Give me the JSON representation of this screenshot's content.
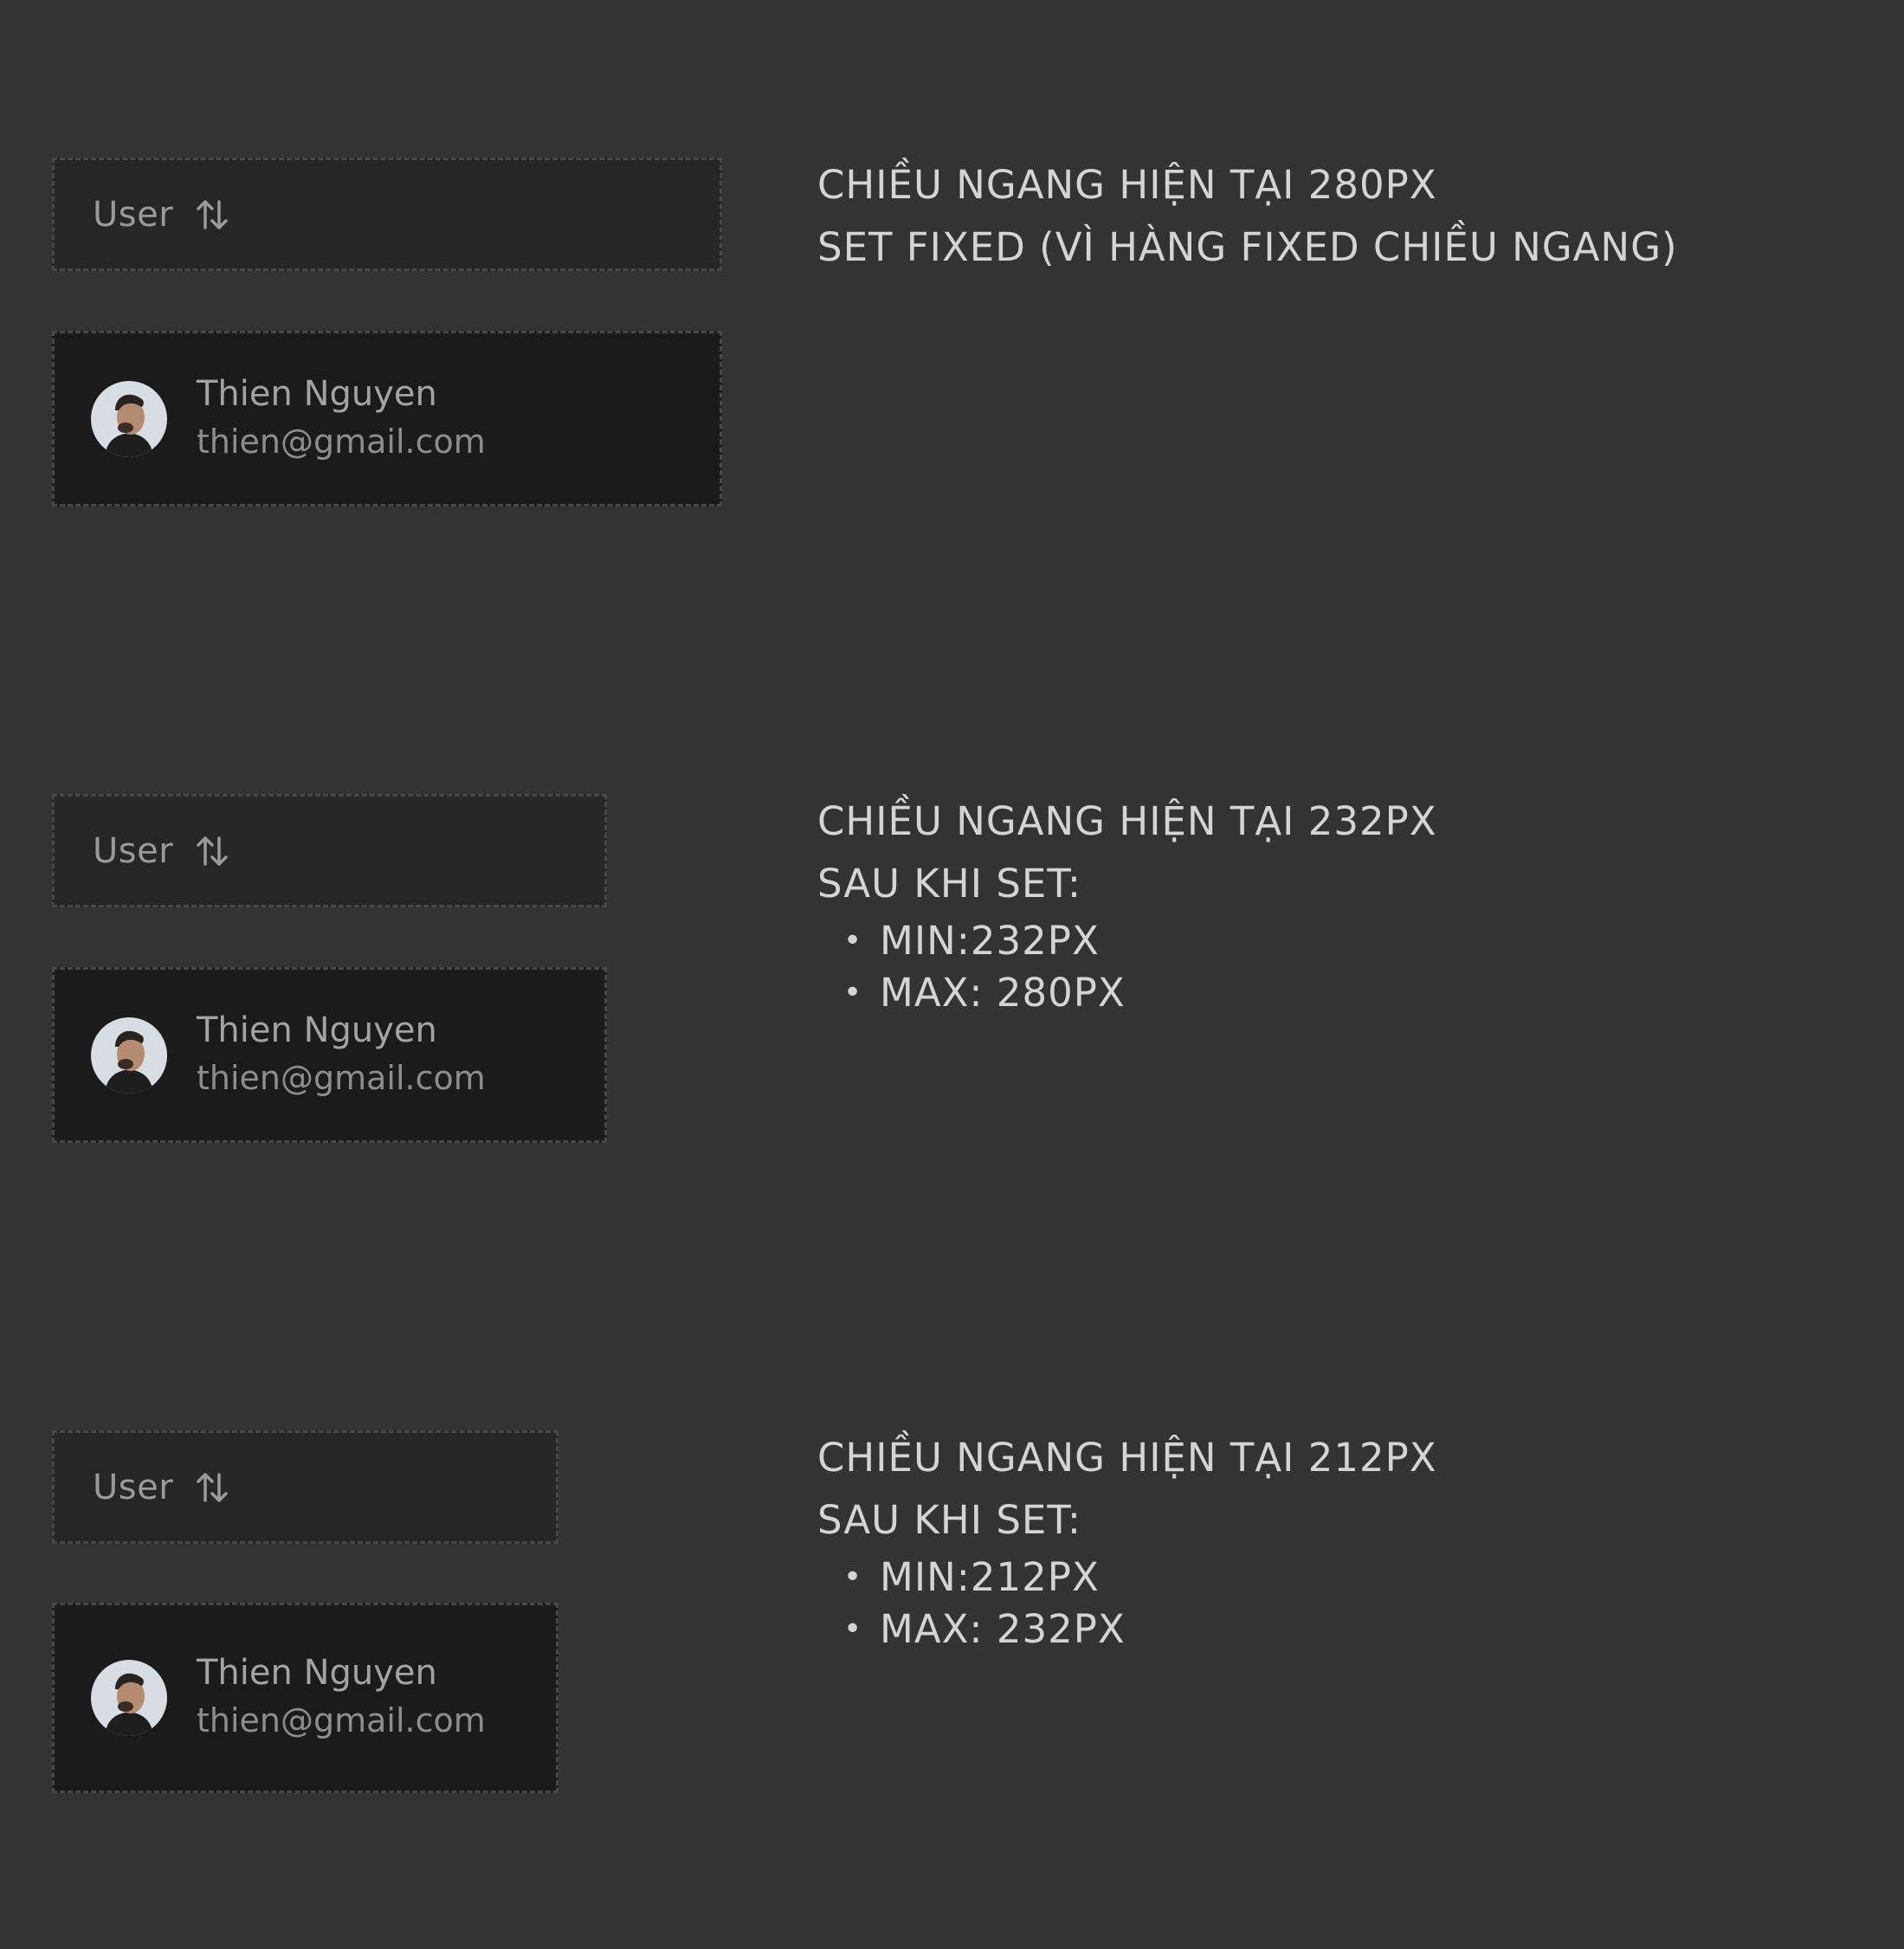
{
  "colors": {
    "background": "#333333",
    "header_cell_bg": "#262626",
    "user_cell_bg": "#1b1b1b",
    "dashed_border": "#474747",
    "note_text": "#d4d4d4"
  },
  "sections": [
    {
      "header": {
        "label": "User",
        "icon": "sort-arrows-icon"
      },
      "user": {
        "name": "Thien Nguyen",
        "email": "thien@gmail.com",
        "avatar": "avatar-photo"
      },
      "note": {
        "lines": [
          "CHIỀU NGANG HIỆN TẠI 280PX",
          "SET FIXED (VÌ HÀNG FIXED CHIỀU NGANG)"
        ],
        "bullets": []
      }
    },
    {
      "header": {
        "label": "User",
        "icon": "sort-arrows-icon"
      },
      "user": {
        "name": "Thien Nguyen",
        "email": "thien@gmail.com",
        "avatar": "avatar-photo"
      },
      "note": {
        "lines": [
          "CHIỀU NGANG HIỆN TẠI 232PX",
          "SAU KHI SET:"
        ],
        "bullets": [
          "MIN:232PX",
          "MAX: 280PX"
        ]
      }
    },
    {
      "header": {
        "label": "User",
        "icon": "sort-arrows-icon"
      },
      "user": {
        "name": "Thien Nguyen",
        "email": "thien@gmail.com",
        "avatar": "avatar-photo"
      },
      "note": {
        "lines": [
          "CHIỀU NGANG HIỆN TẠI 212PX",
          "SAU KHI SET:"
        ],
        "bullets": [
          "MIN:212PX",
          "MAX: 232PX"
        ]
      }
    }
  ]
}
